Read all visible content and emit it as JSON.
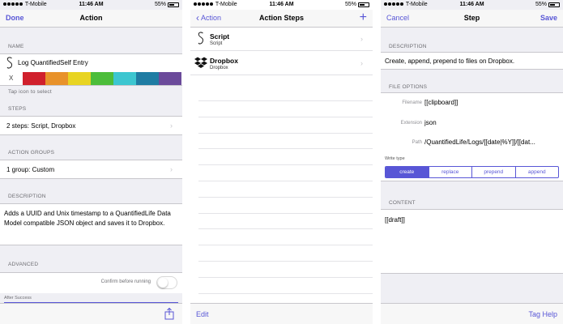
{
  "status": {
    "carrier": "T-Mobile",
    "time": "11:46 AM",
    "battery": "55%"
  },
  "colors": {
    "accent": "#5856d6",
    "background": "#efeff4"
  },
  "screen1": {
    "nav": {
      "left": "Done",
      "title": "Action"
    },
    "name_header": "NAME",
    "name_value": "Log QuantifiedSelf Entry",
    "clear_glyph": "X",
    "swatches": [
      "#d0202c",
      "#e8922a",
      "#e8d422",
      "#4cbd3a",
      "#3cc6d0",
      "#1f7ca3",
      "#6b4a9a"
    ],
    "tap_hint": "Tap icon to select",
    "steps_header": "STEPS",
    "steps_value": "2 steps: Script, Dropbox",
    "groups_header": "ACTION GROUPS",
    "groups_value": "1 group: Custom",
    "description_header": "DESCRIPTION",
    "description": "Adds a UUID and Unix timestamp to a QuantifiedLife Data Model compatible JSON object and saves it to Dropbox.",
    "advanced_header": "ADVANCED",
    "confirm_label": "Confirm before running",
    "after_success": "After Success",
    "share_icon": "share-icon"
  },
  "screen2": {
    "nav": {
      "left": "Action",
      "title": "Action Steps",
      "right": "+"
    },
    "steps": [
      {
        "title": "Script",
        "subtitle": "Script",
        "icon": "script-icon"
      },
      {
        "title": "Dropbox",
        "subtitle": "Dropbox",
        "icon": "dropbox-icon"
      }
    ],
    "edit": "Edit"
  },
  "screen3": {
    "nav": {
      "left": "Cancel",
      "title": "Step",
      "right": "Save"
    },
    "description_header": "DESCRIPTION",
    "description": "Create, append, prepend to files on Dropbox.",
    "file_options_header": "FILE OPTIONS",
    "fields": [
      {
        "label": "Filename",
        "value": "[[clipboard]]"
      },
      {
        "label": "Extension",
        "value": "json"
      },
      {
        "label": "Path",
        "value": "/QuantifiedLife/Logs/[[date|%Y]]/[[dat..."
      }
    ],
    "write_type_label": "Write type",
    "write_types": [
      "create",
      "replace",
      "prepend",
      "append"
    ],
    "write_type_selected": "create",
    "content_header": "CONTENT",
    "content_value": "[[draft]]",
    "tag_help": "Tag Help"
  }
}
